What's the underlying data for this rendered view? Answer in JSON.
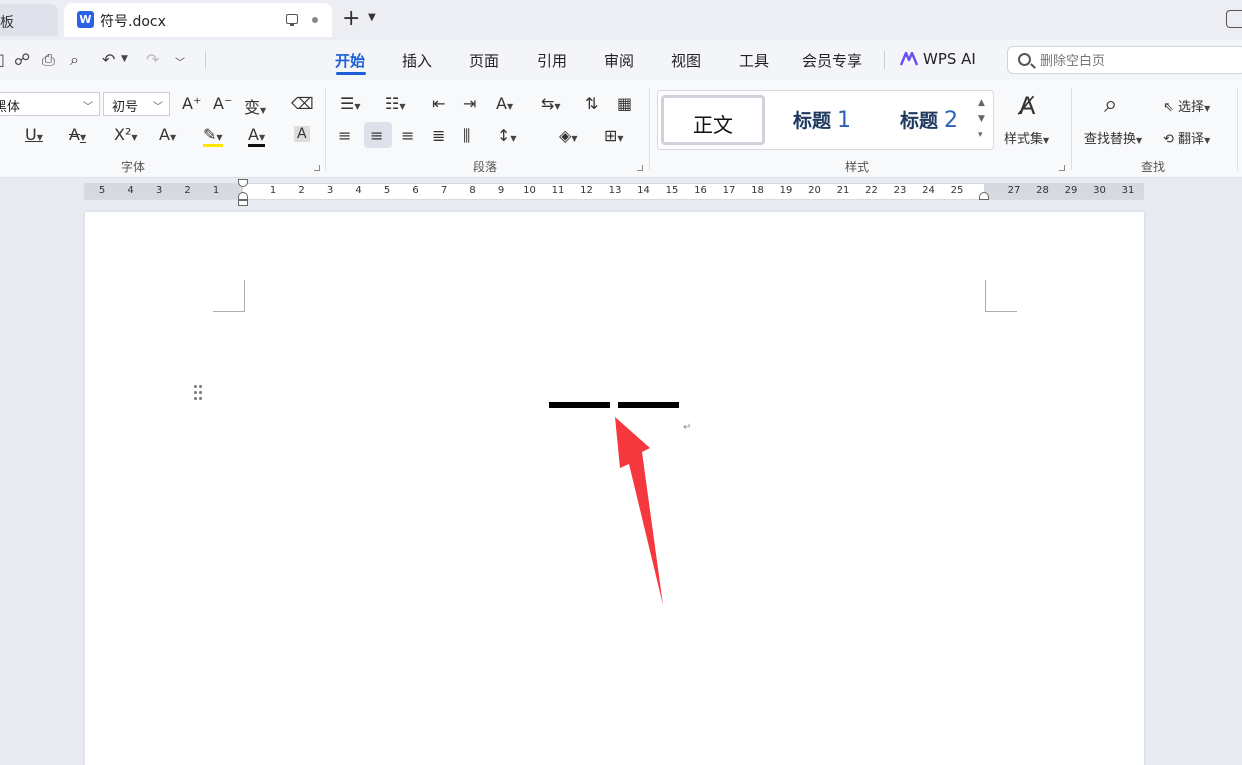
{
  "tabs": {
    "prev_label": "模板",
    "active_label": "符号.docx",
    "doc_badge": "W",
    "new_tab": "+"
  },
  "menu": {
    "items": [
      "开始",
      "插入",
      "页面",
      "引用",
      "审阅",
      "视图",
      "工具",
      "会员专享"
    ],
    "wps_ai": "WPS AI",
    "search_placeholder": "删除空白页"
  },
  "font": {
    "name": "黑体",
    "size": "初号",
    "group_label": "字体"
  },
  "paragraph": {
    "group_label": "段落"
  },
  "styles": {
    "body": "正文",
    "heading1": "标题",
    "heading1_num": "1",
    "heading2": "标题",
    "heading2_num": "2",
    "style_set": "样式集",
    "group_label": "样式"
  },
  "find": {
    "find_replace": "查找替换",
    "select": "选择",
    "translate": "翻译",
    "group_label": "查找"
  },
  "ruler": {
    "ticks": [
      "5",
      "4",
      "3",
      "2",
      "1",
      "",
      "1",
      "2",
      "3",
      "4",
      "5",
      "6",
      "7",
      "8",
      "9",
      "10",
      "11",
      "12",
      "13",
      "14",
      "15",
      "16",
      "17",
      "18",
      "19",
      "20",
      "21",
      "22",
      "23",
      "24",
      "25",
      "",
      "27",
      "28",
      "29",
      "30",
      "31"
    ]
  },
  "colors": {
    "accent": "#1a5fd8",
    "arrow": "#f5383d",
    "highlight": "#ffe600",
    "font_color": "#e02020"
  },
  "document": {
    "content": "——"
  }
}
